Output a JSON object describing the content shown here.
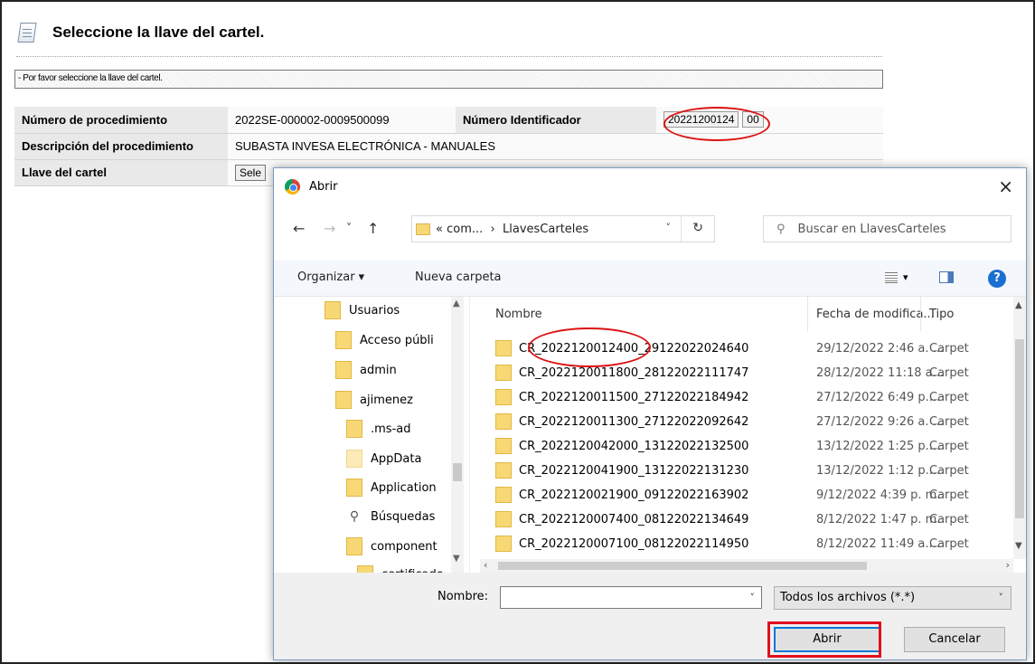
{
  "page": {
    "title": "Seleccione la llave del cartel.",
    "message": "- Por favor seleccione la llave del cartel.",
    "fields": {
      "procedure_number_label": "Número de procedimiento",
      "procedure_number_value": "2022SE-000002-0009500099",
      "identifier_label": "Número Identificador",
      "identifier_value": "20221200124",
      "identifier_suffix": "00",
      "description_label": "Descripción del procedimiento",
      "description_value": "SUBASTA INVESA ELECTRÓNICA - MANUALES",
      "key_label": "Llave del cartel",
      "select_button": "Sele"
    }
  },
  "dialog": {
    "title": "Abrir",
    "close": "×",
    "nav": {
      "back": "←",
      "forward": "→",
      "recent": "˅",
      "up": "↑"
    },
    "address": {
      "prefix": "«",
      "crumbs": [
        "com...",
        "LlavesCarteles"
      ],
      "separator": "›",
      "dropdown": "˅",
      "refresh": "↻"
    },
    "search_placeholder": "Buscar en LlavesCarteles",
    "toolbar": {
      "organize": "Organizar ▾",
      "new_folder": "Nueva carpeta",
      "help": "?"
    },
    "tree": [
      {
        "label": "Usuarios",
        "icon": "folder-icon"
      },
      {
        "label": "Acceso públi",
        "icon": "folder-icon"
      },
      {
        "label": "admin",
        "icon": "folder-icon"
      },
      {
        "label": "ajimenez",
        "icon": "folder-icon"
      },
      {
        "label": ".ms-ad",
        "icon": "folder-icon"
      },
      {
        "label": "AppData",
        "icon": "folder-pale-icon"
      },
      {
        "label": "Application",
        "icon": "folder-icon"
      },
      {
        "label": "Búsquedas",
        "icon": "search-icon"
      },
      {
        "label": "component",
        "icon": "folder-icon"
      },
      {
        "label": "certificado",
        "icon": "folder-icon"
      }
    ],
    "columns": {
      "name": "Nombre",
      "date": "Fecha de modifica...",
      "type": "Tipo"
    },
    "files": [
      {
        "name": "CR_2022120012400_29122022024640",
        "date": "29/12/2022 2:46 a. ...",
        "type": "Carpet"
      },
      {
        "name": "CR_2022120011800_28122022111747",
        "date": "28/12/2022 11:18 a...",
        "type": "Carpet"
      },
      {
        "name": "CR_2022120011500_27122022184942",
        "date": "27/12/2022 6:49 p....",
        "type": "Carpet"
      },
      {
        "name": "CR_2022120011300_27122022092642",
        "date": "27/12/2022 9:26 a. ...",
        "type": "Carpet"
      },
      {
        "name": "CR_2022120042000_13122022132500",
        "date": "13/12/2022 1:25 p....",
        "type": "Carpet"
      },
      {
        "name": "CR_2022120041900_13122022131230",
        "date": "13/12/2022 1:12 p....",
        "type": "Carpet"
      },
      {
        "name": "CR_2022120021900_09122022163902",
        "date": "9/12/2022 4:39 p. m.",
        "type": "Carpet"
      },
      {
        "name": "CR_2022120007400_08122022134649",
        "date": "8/12/2022 1:47 p. m.",
        "type": "Carpet"
      },
      {
        "name": "CR_2022120007100_08122022114950",
        "date": "8/12/2022 11:49 a....",
        "type": "Carpet"
      }
    ],
    "filename_label": "Nombre:",
    "filename_value": "",
    "filter": "Todos los archivos (*.*)",
    "open_button": "Abrir",
    "cancel_button": "Cancelar"
  },
  "colors": {
    "annotation_red": "#d11111",
    "folder_yellow": "#f8d775",
    "accent_blue": "#0078d7"
  }
}
